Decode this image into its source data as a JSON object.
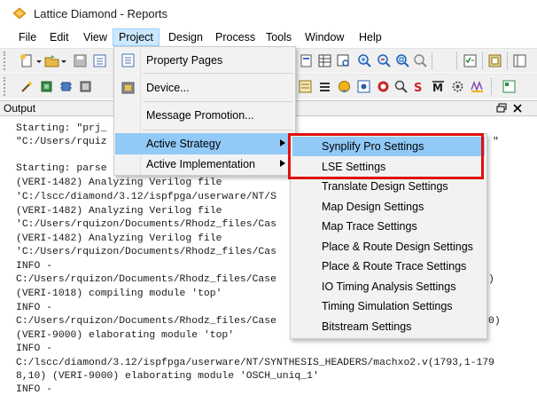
{
  "window": {
    "title": "Lattice Diamond - Reports"
  },
  "menubar": {
    "items": [
      {
        "label": "File"
      },
      {
        "label": "Edit"
      },
      {
        "label": "View"
      },
      {
        "label": "Project"
      },
      {
        "label": "Design"
      },
      {
        "label": "Process"
      },
      {
        "label": "Tools"
      },
      {
        "label": "Window"
      },
      {
        "label": "Help"
      }
    ],
    "active": "Project"
  },
  "output_pane": {
    "title": "Output",
    "pin_glyph": "ᵷ",
    "close_glyph": "×",
    "lines": [
      "Starting: \"prj_",
      "\"C:/Users/rquiz",
      "",
      "Starting: parse",
      "(VERI-1482) Analyzing Verilog file",
      "'C:/lscc/diamond/3.12/ispfpga/userware/NT/S",
      "(VERI-1482) Analyzing Verilog file",
      "'C:/Users/rquizon/Documents/Rhodz_files/Cas",
      "(VERI-1482) Analyzing Verilog file",
      "'C:/Users/rquizon/Documents/Rhodz_files/Cas",
      "INFO -",
      "C:/Users/rquizon/Documents/Rhodz_files/Case",
      "(VERI-1018) compiling module 'top'",
      "INFO -",
      "C:/Users/rquizon/Documents/Rhodz_files/Case",
      "(VERI-9000) elaborating module 'top'",
      "INFO -",
      "C:/lscc/diamond/3.12/ispfpga/userware/NT/SYNTHESIS_HEADERS/machxo2.v(1793,1-179",
      "8,10) (VERI-9000) elaborating module 'OSCH_uniq_1'",
      "INFO -"
    ],
    "right_fragments": [
      {
        "text": "\"",
        "row": 1
      },
      {
        "text": ")",
        "row": 11
      },
      {
        "text": "0)",
        "row": 14
      }
    ]
  },
  "project_menu": {
    "items": [
      {
        "label": "Property Pages",
        "icon": "property-pages-icon",
        "submenu": false
      },
      {
        "label": "Device...",
        "icon": "device-icon",
        "submenu": false
      },
      {
        "label": "Message Promotion...",
        "icon": "",
        "submenu": false
      },
      {
        "label": "Active Strategy",
        "icon": "",
        "submenu": true
      },
      {
        "label": "Active Implementation",
        "icon": "",
        "submenu": true
      }
    ],
    "highlighted": "Active Strategy"
  },
  "strategy_submenu": {
    "items": [
      {
        "label": "Synplify Pro Settings"
      },
      {
        "label": "LSE Settings"
      },
      {
        "label": "Translate Design Settings"
      },
      {
        "label": "Map Design Settings"
      },
      {
        "label": "Map Trace Settings"
      },
      {
        "label": "Place & Route Design Settings"
      },
      {
        "label": "Place & Route Trace Settings"
      },
      {
        "label": "IO Timing Analysis Settings"
      },
      {
        "label": "Timing Simulation Settings"
      },
      {
        "label": "Bitstream Settings"
      }
    ],
    "highlighted": "Synplify Pro Settings",
    "annotation_color": "#e01010"
  },
  "colors": {
    "highlight": "#91c9f7",
    "menu_active": "#cce8ff",
    "annotation": "#e01010"
  }
}
